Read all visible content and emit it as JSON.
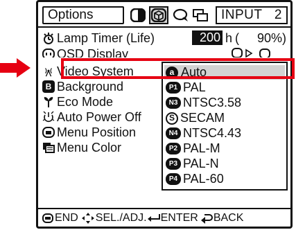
{
  "header": {
    "tab_label": "Options",
    "input_label": "INPUT",
    "input_number": "2"
  },
  "menu": {
    "lamp_timer": {
      "label": "Lamp Timer  (Life)",
      "hours": "200",
      "unit": "h",
      "paren_open": "(",
      "percent": "90%)"
    },
    "osd_display": {
      "label": "OSD Display"
    },
    "video_system": {
      "label": "Video System"
    },
    "background": {
      "label": "Background"
    },
    "eco_mode": {
      "label": "Eco Mode"
    },
    "auto_power_off": {
      "label": "Auto Power Off"
    },
    "menu_position": {
      "label": "Menu Position"
    },
    "menu_color": {
      "label": "Menu Color"
    }
  },
  "submenu": {
    "items": [
      {
        "badge": "a",
        "label": "Auto",
        "selected": true
      },
      {
        "badge": "P1",
        "label": "PAL"
      },
      {
        "badge": "N3",
        "label": "NTSC3.58"
      },
      {
        "badge": "S",
        "label": "SECAM"
      },
      {
        "badge": "N4",
        "label": "NTSC4.43"
      },
      {
        "badge": "P2",
        "label": "PAL-M"
      },
      {
        "badge": "P3",
        "label": "PAL-N"
      },
      {
        "badge": "P4",
        "label": "PAL-60"
      }
    ]
  },
  "footer": {
    "end_label": "END",
    "sel_label": "SEL./ADJ.",
    "enter_label": "ENTER",
    "back_label": "BACK"
  },
  "colors": {
    "highlight": "#e60012",
    "selected_bg": "#d3d3d3"
  }
}
